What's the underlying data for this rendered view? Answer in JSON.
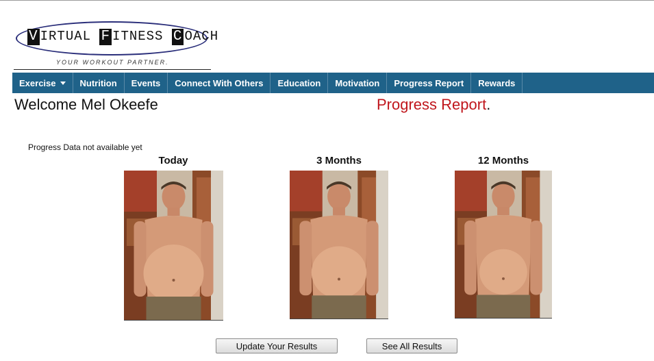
{
  "logo": {
    "brand": [
      {
        "cap": "V",
        "rest": "IRTUAL "
      },
      {
        "cap": "F",
        "rest": "ITNESS "
      },
      {
        "cap": "C",
        "rest": "OACH"
      }
    ],
    "tagline": "YOUR WORKOUT PARTNER."
  },
  "nav": {
    "items": [
      {
        "label": "Exercise",
        "has_dropdown": true
      },
      {
        "label": "Nutrition"
      },
      {
        "label": "Events"
      },
      {
        "label": "Connect With Others"
      },
      {
        "label": "Education"
      },
      {
        "label": "Motivation"
      },
      {
        "label": "Progress Report"
      },
      {
        "label": "Rewards"
      }
    ],
    "background": "#1f6289"
  },
  "welcome": "Welcome Mel Okeefe",
  "report_title": "Progress Report",
  "report_title_suffix": ".",
  "status_note": "Progress Data not available yet",
  "photos": [
    {
      "label": "Today",
      "belly": 1.0
    },
    {
      "label": "3 Months",
      "belly": 0.75
    },
    {
      "label": "12 Months",
      "belly": 0.4
    }
  ],
  "buttons": {
    "update": "Update Your Results",
    "see_all": "See All Results"
  },
  "colors": {
    "accent_red": "#c0161c",
    "nav_blue": "#1f6289"
  }
}
